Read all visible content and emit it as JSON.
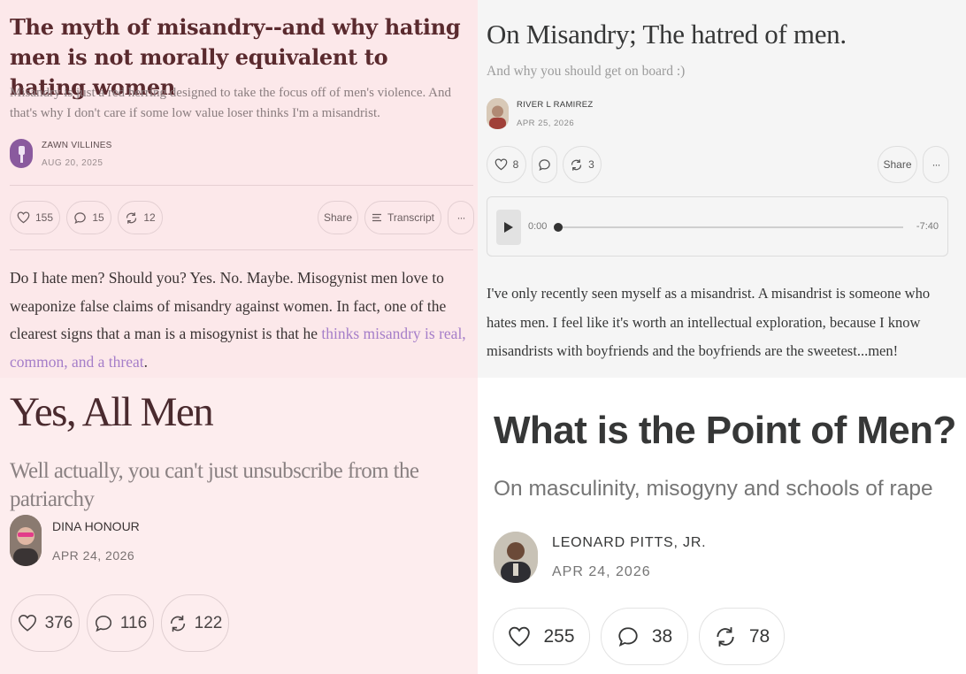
{
  "post1": {
    "title": "The myth of misandry--and why hating men is not morally equivalent to hating women",
    "subtitle": "Misandry is just a red herring designed to take the focus off of men's violence. And that's why I don't care if some low value loser thinks I'm a misandrist.",
    "author": "ZAWN VILLINES",
    "date": "AUG 20, 2025",
    "likes": "155",
    "comments": "15",
    "restacks": "12",
    "share_label": "Share",
    "transcript_label": "Transcript",
    "more_label": "···",
    "body_text": "Do I hate men? Should you? Yes. No. Maybe. Misogynist men love to weaponize false claims of misandry against women. In fact, one of the clearest signs that a man is a misogynist is that he ",
    "body_link": "thinks misandry is real, common, and a threat",
    "body_end": "."
  },
  "post2": {
    "title": "On Misandry; The hatred of men.",
    "subtitle": "And why you should get on board :)",
    "author": "RIVER L RAMIREZ",
    "date": "APR 25, 2026",
    "likes": "8",
    "restacks": "3",
    "share_label": "Share",
    "more_label": "···",
    "audio": {
      "current_time": "0:00",
      "remaining_time": "-7:40",
      "progress": 0.0
    },
    "body_text": "I've only recently seen myself as a misandrist. A misandrist is someone who hates men. I feel like it's worth an intellectual exploration, because I know misandrists with boyfriends and the boyfriends are the sweetest...men!"
  },
  "post3": {
    "title": "Yes, All Men",
    "subtitle": "Well actually, you can't just unsubscribe from the patriarchy",
    "author": "DINA HONOUR",
    "date": "APR 24, 2026",
    "likes": "376",
    "comments": "116",
    "restacks": "122"
  },
  "post4": {
    "title": "What is the Point of Men?",
    "subtitle": "On masculinity, misogyny and schools of rape",
    "author": "LEONARD PITTS, JR.",
    "date": "APR 24, 2026",
    "likes": "255",
    "comments": "38",
    "restacks": "78"
  },
  "colors": {
    "post1_bg": "#fce8ea",
    "post1_title": "#5a2a2e",
    "post2_bg": "#f5f5f5",
    "post3_bg": "#fdedee",
    "post3_title": "#4a2a2e",
    "post4_bg": "#ffffff",
    "link": "#a57ec9"
  }
}
